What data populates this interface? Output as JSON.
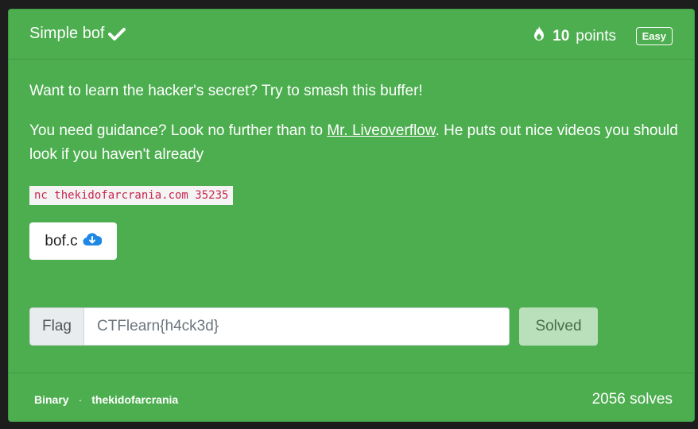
{
  "challenge": {
    "title": "Simple bof",
    "points_value": "10",
    "points_label": "points",
    "difficulty": "Easy",
    "description_1": "Want to learn the hacker's secret? Try to smash this buffer!",
    "description_2_before": "You need guidance? Look no further than to ",
    "description_2_link": "Mr. Liveoverflow",
    "description_2_after": ". He puts out nice videos you should look if you haven't already",
    "command": "nc thekidofarcrania.com 35235",
    "file_name": "bof.c"
  },
  "flag_form": {
    "label": "Flag",
    "value": "CTFlearn{h4ck3d}",
    "submit_label": "Solved"
  },
  "footer": {
    "category": "Binary",
    "separator": "·",
    "author": "thekidofarcrania",
    "solves": "2056 solves"
  },
  "colors": {
    "card_bg": "#4cae4f",
    "page_bg": "#1d1d1d",
    "download_icon": "#1e88e5"
  },
  "icons": {
    "solved": "check-icon",
    "points": "fire-icon",
    "download": "cloud-download-icon"
  }
}
